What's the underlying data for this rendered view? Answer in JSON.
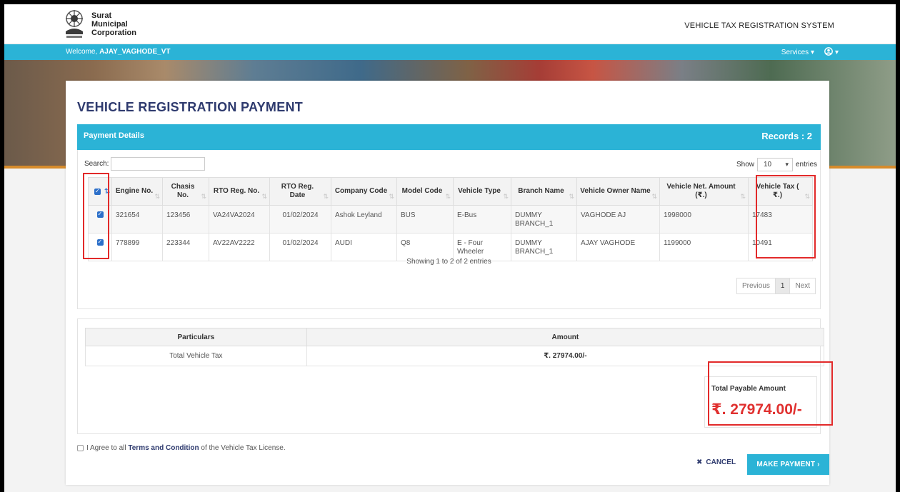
{
  "header": {
    "logo_line1": "Surat",
    "logo_line2": "Municipal",
    "logo_line3": "Corporation",
    "system_title": "VEHICLE TAX REGISTRATION SYSTEM"
  },
  "navbar": {
    "welcome_prefix": "Welcome, ",
    "username": "AJAY_VAGHODE_VT",
    "services_label": "Services",
    "services_caret": "▾",
    "user_caret": "▾"
  },
  "page": {
    "title": "VEHICLE REGISTRATION PAYMENT"
  },
  "payment_details": {
    "title": "Payment Details",
    "records": "Records : 2",
    "search_label": "Search:",
    "search_value": "",
    "show_label": "Show",
    "show_value": "10",
    "entries_label": "entries",
    "columns": [
      "Engine No.",
      "Chasis No.",
      "RTO Reg. No.",
      "RTO Reg. Date",
      "Company Code",
      "Model Code",
      "Vehicle Type",
      "Branch Name",
      "Vehicle Owner Name",
      "Vehicle Net. Amount (₹.)",
      "Vehicle Tax ( ₹.)"
    ],
    "rows": [
      {
        "checked": true,
        "engine": "321654",
        "chasis": "123456",
        "rto_no": "VA24VA2024",
        "rto_date": "01/02/2024",
        "company": "Ashok Leyland",
        "model": "BUS",
        "type": "E-Bus",
        "branch": "DUMMY BRANCH_1",
        "owner": "VAGHODE AJ",
        "net_amount": "1998000",
        "tax": "17483"
      },
      {
        "checked": true,
        "engine": "778899",
        "chasis": "223344",
        "rto_no": "AV22AV2222",
        "rto_date": "01/02/2024",
        "company": "AUDI",
        "model": "Q8",
        "type": "E - Four Wheeler",
        "branch": "DUMMY BRANCH_1",
        "owner": "AJAY VAGHODE",
        "net_amount": "1199000",
        "tax": "10491"
      }
    ],
    "showing": "Showing 1 to 2 of 2 entries",
    "pager": {
      "previous": "Previous",
      "current": "1",
      "next": "Next"
    }
  },
  "totals": {
    "col_particulars": "Particulars",
    "col_amount": "Amount",
    "row_label": "Total Vehicle Tax",
    "row_amount": "₹. 27974.00/-",
    "payable_label": "Total Payable Amount",
    "payable_amount": "₹. 27974.00/-"
  },
  "agree": {
    "prefix": "I Agree to all ",
    "link": "Terms and Condition",
    "suffix": " of the Vehicle Tax License."
  },
  "actions": {
    "cancel_icon": "✖",
    "cancel_label": "CANCEL",
    "pay_label": "MAKE PAYMENT ›"
  },
  "colors": {
    "accent": "#2bb3d6",
    "title": "#2e3a6e",
    "highlight": "#e22a2a",
    "amount": "#e0302f"
  }
}
